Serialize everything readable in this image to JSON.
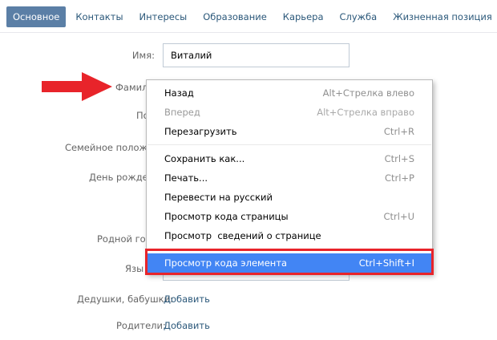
{
  "tabs": [
    {
      "label": "Основное",
      "active": true
    },
    {
      "label": "Контакты",
      "active": false
    },
    {
      "label": "Интересы",
      "active": false
    },
    {
      "label": "Образование",
      "active": false
    },
    {
      "label": "Карьера",
      "active": false
    },
    {
      "label": "Служба",
      "active": false
    },
    {
      "label": "Жизненная позиция",
      "active": false
    }
  ],
  "form": {
    "name_label": "Имя:",
    "name_value": "Виталий",
    "surname_label": "Фамили",
    "gender_label": "По",
    "marital_label": "Семейное положен",
    "birthday_label": "День рожден",
    "hometown_label": "Родной горо",
    "languages_label": "Язы",
    "grandparents_label": "Дедушки, бабушки:",
    "grandparents_link": "Добавить",
    "parents_label": "Родители:",
    "parents_link": "Добавить"
  },
  "context_menu": {
    "items": [
      {
        "label": "Назад",
        "shortcut": "Alt+Стрелка влево"
      },
      {
        "label": "Вперед",
        "shortcut": "Alt+Стрелка вправо"
      },
      {
        "label": "Перезагрузить",
        "shortcut": "Ctrl+R"
      },
      {
        "label": "Сохранить как...",
        "shortcut": "Ctrl+S"
      },
      {
        "label": "Печать...",
        "shortcut": "Ctrl+P"
      },
      {
        "label": "Перевести на русский",
        "shortcut": ""
      },
      {
        "label": "Просмотр кода страницы",
        "shortcut": "Ctrl+U"
      },
      {
        "label": "Просмотр  сведений о странице",
        "shortcut": ""
      },
      {
        "label": "Просмотр кода элемента",
        "shortcut": "Ctrl+Shift+I"
      }
    ]
  },
  "colors": {
    "accent_tab": "#5b7fa6",
    "link": "#2b587a",
    "highlight": "#4285f4",
    "annotation_red": "#e8242a"
  },
  "icons": {
    "pointer_arrow": "arrow-right-icon"
  }
}
